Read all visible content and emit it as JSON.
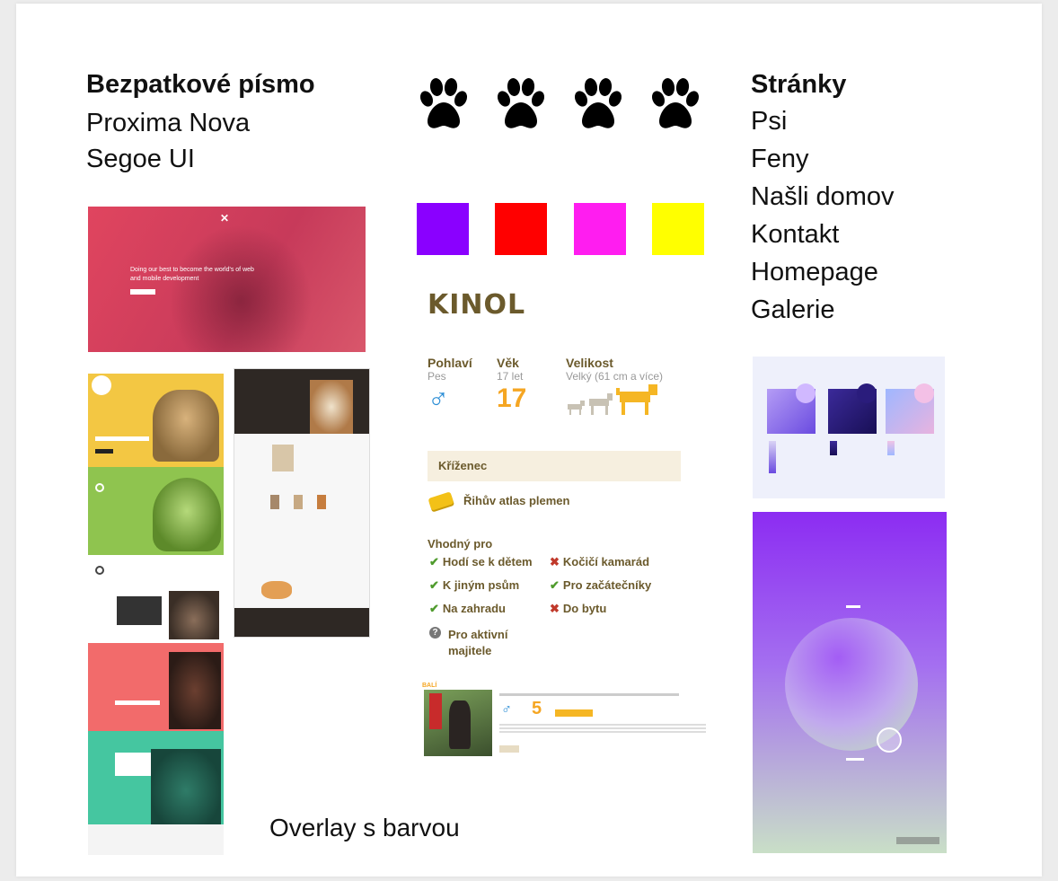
{
  "typography": {
    "heading": "Bezpatkové písmo",
    "fonts": [
      "Proxima Nova",
      "Segoe UI"
    ]
  },
  "paw_icons": [
    "paw-icon",
    "paw-icon",
    "paw-icon",
    "paw-icon"
  ],
  "swatches": [
    "#8a00ff",
    "#ff0000",
    "#ff1df0",
    "#ffff00"
  ],
  "pages": {
    "heading": "Stránky",
    "items": [
      "Psi",
      "Feny",
      "Našli domov",
      "Kontakt",
      "Homepage",
      "Galerie"
    ]
  },
  "hero_text": "Doing our best to become the world's of web and mobile development",
  "kinol": {
    "title": "KINOL",
    "gender_label": "Pohlaví",
    "gender_value": "Pes",
    "gender_symbol": "♂",
    "age_label": "Věk",
    "age_value": "17 let",
    "age_big": "17",
    "size_label": "Velikost",
    "size_value": "Velký (61 cm a více)",
    "breed": "Kříženec",
    "atlas_link": "Řihův atlas plemen",
    "suitable_heading": "Vhodný pro",
    "suitable_items": [
      {
        "text": "Hodí se k dětem",
        "ok": true
      },
      {
        "text": "Kočičí kamarád",
        "ok": false
      },
      {
        "text": "K jiným psům",
        "ok": true
      },
      {
        "text": "Pro začátečníky",
        "ok": true
      },
      {
        "text": "Na zahradu",
        "ok": true
      },
      {
        "text": "Do bytu",
        "ok": false
      }
    ],
    "unknown_item": "Pro aktivní majitele",
    "mini": {
      "name": "BALÍ",
      "age_big": "5",
      "gender_symbol": "♂"
    }
  },
  "overlay_caption": "Overlay s barvou",
  "colors": {
    "brown": "#6b5a2c",
    "check": "#4f9b2d",
    "cross": "#c0392b",
    "male_blue": "#2e8fd6",
    "age_orange": "#f5a623",
    "breed_bg": "#f6efdf"
  }
}
